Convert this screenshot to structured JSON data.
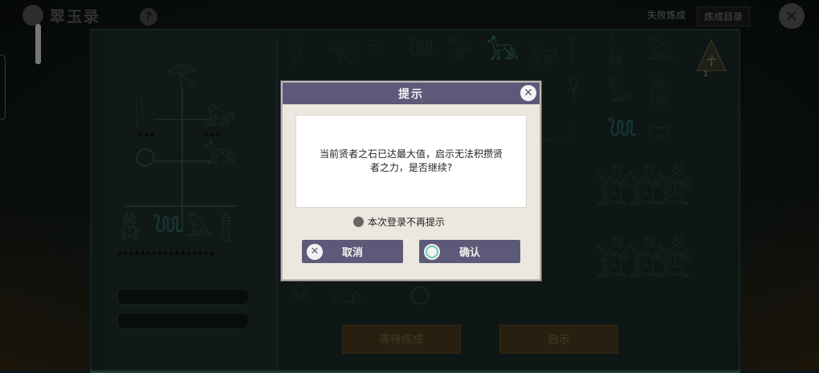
{
  "header": {
    "app_title": "翠玉录",
    "help_symbol": "?",
    "failed_refine_label": "失败炼成",
    "refine_catalog_label": "炼成目录",
    "close_symbol": "✕",
    "ankh_count": "1"
  },
  "bottom_buttons": {
    "wait_refine_label": "等待炼成",
    "reveal_label": "启示"
  },
  "dialog": {
    "title": "提示",
    "close_symbol": "✕",
    "message": "当前贤者之石已达最大值，启示无法积攒贤者之力，是否继续?",
    "checkbox_label": "本次登录不再提示",
    "cancel_label": "取消",
    "cancel_icon": "x-icon",
    "confirm_label": "确认",
    "confirm_icon": "ring-icon"
  },
  "colors": {
    "dialog_header": "#5d5a79",
    "dialog_body": "#ece8e0",
    "glyph_active": "#3f9c8c",
    "board_bg": "#1b2a27"
  }
}
